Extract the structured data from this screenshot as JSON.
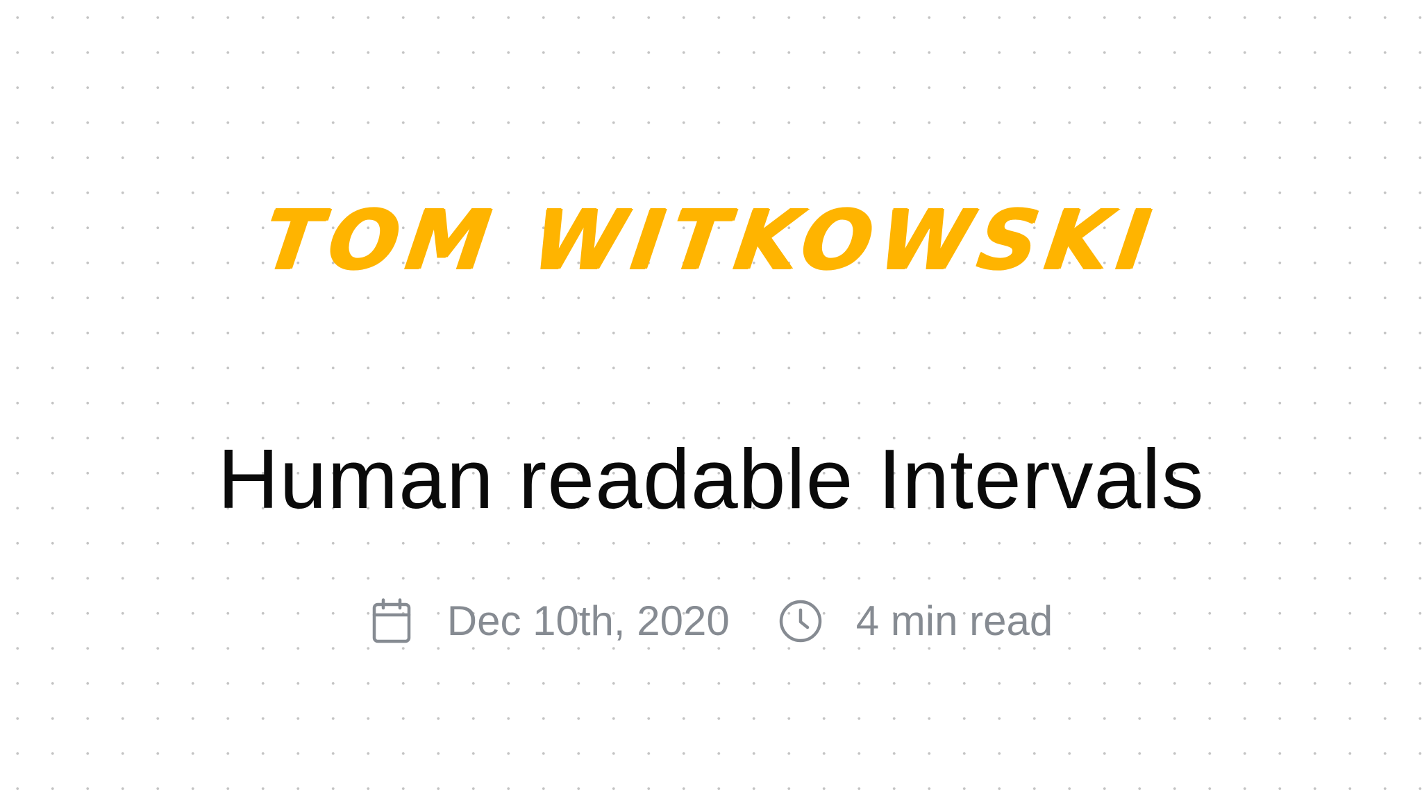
{
  "brand": {
    "name": "Tom Witkowski",
    "color": "#ffb400"
  },
  "post": {
    "title": "Human readable Intervals",
    "date": "Dec 10th, 2020",
    "reading_time": "4 min read"
  },
  "icons": {
    "date": "calendar-icon",
    "reading_time": "clock-icon"
  },
  "colors": {
    "background": "#ffffff",
    "dots": "#c4c4c4",
    "title": "#0a0a0a",
    "meta": "#868b92"
  }
}
